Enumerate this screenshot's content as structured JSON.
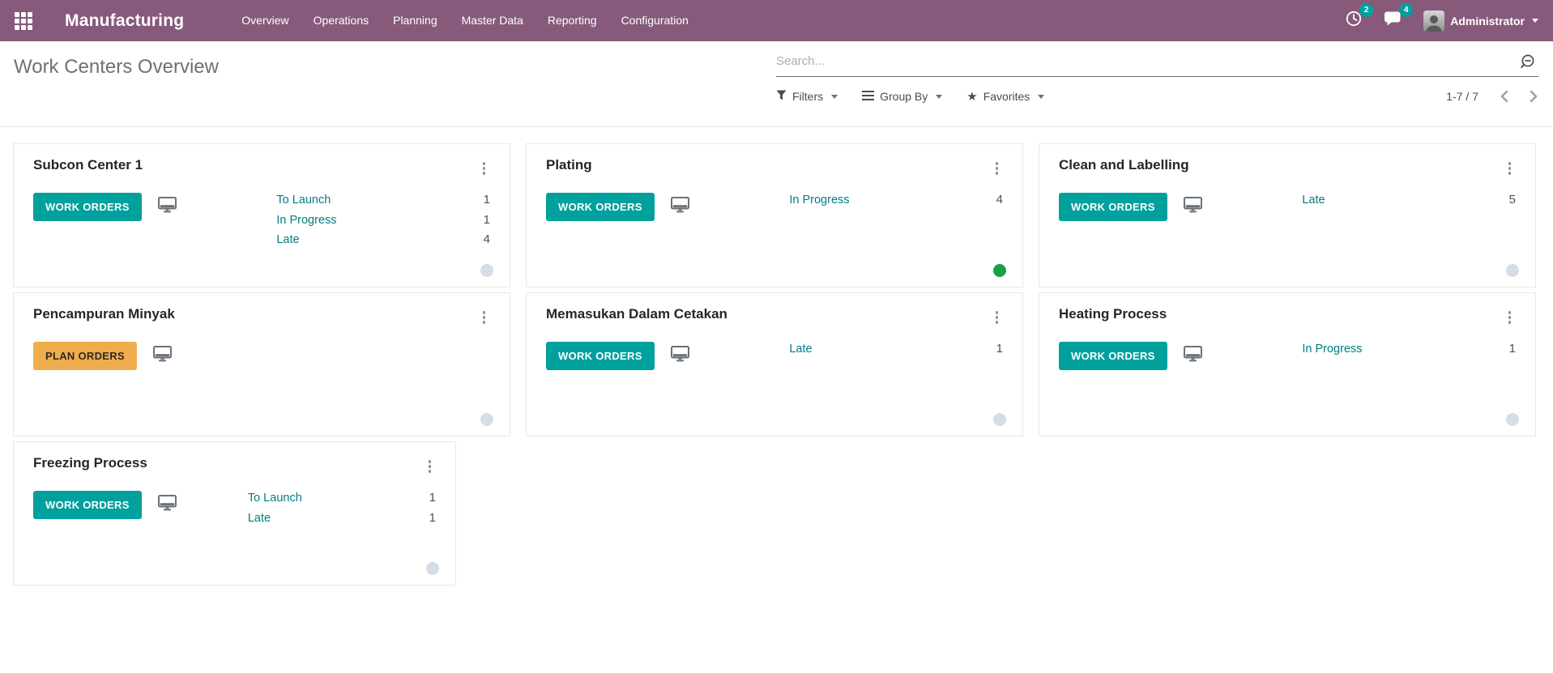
{
  "navbar": {
    "brand": "Manufacturing",
    "menu_items": [
      "Overview",
      "Operations",
      "Planning",
      "Master Data",
      "Reporting",
      "Configuration"
    ],
    "activity_badge": "2",
    "messages_badge": "4",
    "user_name": "Administrator"
  },
  "control_panel": {
    "title": "Work Centers Overview",
    "search_placeholder": "Search...",
    "filters_label": "Filters",
    "group_by_label": "Group By",
    "favorites_label": "Favorites",
    "pager_text": "1-7 / 7"
  },
  "colors": {
    "navbar_bg": "#875A7B",
    "accent_teal": "#00a09d",
    "warning_orange": "#f0ad4e",
    "status_link": "#017e84",
    "dot_gray": "#d6dde5",
    "dot_green": "#18a049"
  },
  "cards": [
    {
      "title": "Subcon Center 1",
      "button": "WORK ORDERS",
      "button_type": "primary",
      "statuses": [
        {
          "label": "To Launch",
          "count": "1"
        },
        {
          "label": "In Progress",
          "count": "1"
        },
        {
          "label": "Late",
          "count": "4"
        }
      ],
      "dot": "gray",
      "narrow": false
    },
    {
      "title": "Plating",
      "button": "WORK ORDERS",
      "button_type": "primary",
      "statuses": [
        {
          "label": "In Progress",
          "count": "4"
        }
      ],
      "dot": "green",
      "narrow": false
    },
    {
      "title": "Clean and Labelling",
      "button": "WORK ORDERS",
      "button_type": "primary",
      "statuses": [
        {
          "label": "Late",
          "count": "5"
        }
      ],
      "dot": "gray",
      "narrow": false
    },
    {
      "title": "Pencampuran Minyak",
      "button": "PLAN ORDERS",
      "button_type": "warning",
      "statuses": [],
      "dot": "gray",
      "narrow": false
    },
    {
      "title": "Memasukan Dalam Cetakan",
      "button": "WORK ORDERS",
      "button_type": "primary",
      "statuses": [
        {
          "label": "Late",
          "count": "1"
        }
      ],
      "dot": "gray",
      "narrow": false
    },
    {
      "title": "Heating Process",
      "button": "WORK ORDERS",
      "button_type": "primary",
      "statuses": [
        {
          "label": "In Progress",
          "count": "1"
        }
      ],
      "dot": "gray",
      "narrow": false
    },
    {
      "title": "Freezing Process",
      "button": "WORK ORDERS",
      "button_type": "primary",
      "statuses": [
        {
          "label": "To Launch",
          "count": "1"
        },
        {
          "label": "Late",
          "count": "1"
        }
      ],
      "dot": "gray",
      "narrow": true
    }
  ]
}
